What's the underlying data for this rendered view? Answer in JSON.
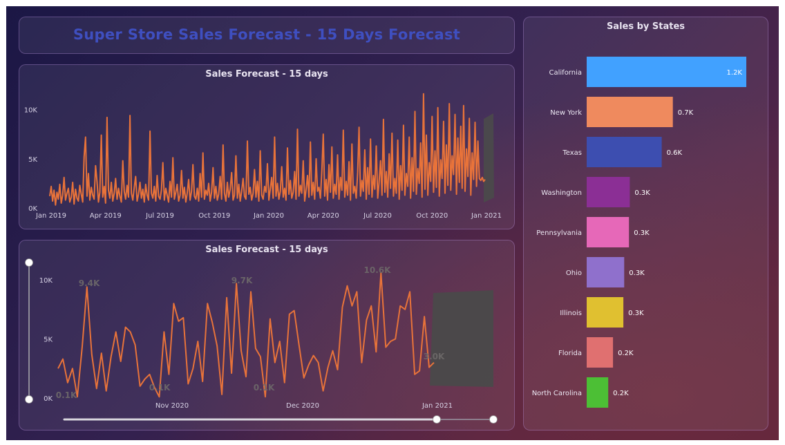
{
  "dashboard": {
    "title": "Super Store Sales Forecast - 15 Days Forecast"
  },
  "colors": {
    "line": "#e8733a",
    "forecast_band": "#4a4a4a",
    "title": "#3f4fc0"
  },
  "chart_data": [
    {
      "type": "line",
      "title": "Sales Forecast - 15 days",
      "x_ticks": [
        "Jan 2019",
        "Apr 2019",
        "Jul 2019",
        "Oct 2019",
        "Jan 2020",
        "Apr 2020",
        "Jul 2020",
        "Oct 2020",
        "Jan 2021"
      ],
      "y_ticks": [
        "0K",
        "5K",
        "10K"
      ],
      "ylim": [
        0,
        12000
      ],
      "x_range": [
        "2019-01-01",
        "2021-01-15"
      ],
      "series": [
        {
          "values": [
            1200,
            2200,
            700,
            1800,
            300,
            1600,
            900,
            2400,
            500,
            1300,
            3100,
            800,
            1500,
            2000,
            600,
            1100,
            2600,
            400,
            1900,
            1000,
            700,
            2300,
            1400,
            600,
            5200,
            7200,
            1200,
            3500,
            800,
            2100,
            1300,
            900,
            4300,
            2700,
            600,
            1600,
            7400,
            1100,
            2200,
            500,
            9200,
            1800,
            1000,
            2600,
            700,
            1500,
            3000,
            900,
            2000,
            1200,
            600,
            4800,
            1700,
            900,
            2300,
            1100,
            9400,
            1500,
            800,
            2100,
            3200,
            700,
            1400,
            2600,
            1000,
            1900,
            600,
            2400,
            1300,
            800,
            7800,
            1500,
            1000,
            2200,
            700,
            3300,
            1200,
            900,
            1800,
            4600,
            800,
            2000,
            1300,
            600,
            2700,
            1100,
            5100,
            900,
            1600,
            2400,
            700,
            1300,
            3800,
            1000,
            2100,
            600,
            1500,
            2900,
            800,
            1700,
            4400,
            1200,
            900,
            2000,
            700,
            3500,
            1100,
            5600,
            900,
            1800,
            1300,
            2500,
            700,
            1600,
            4100,
            1000,
            2200,
            800,
            1400,
            3200,
            900,
            6400,
            1500,
            700,
            2600,
            1100,
            1900,
            3600,
            800,
            1300,
            5300,
            1000,
            2400,
            700,
            1700,
            3000,
            1200,
            900,
            6800,
            1400,
            2100,
            800,
            1500,
            3900,
            1100,
            2700,
            700,
            5800,
            1300,
            900,
            2200,
            1600,
            4500,
            800,
            1900,
            3100,
            1000,
            7200,
            1200,
            2500,
            900,
            1700,
            4200,
            1100,
            2000,
            800,
            6100,
            1400,
            2800,
            1000,
            1600,
            3700,
            900,
            8000,
            1200,
            2300,
            1500,
            4800,
            700,
            1900,
            3300,
            1100,
            6700,
            1300,
            2600,
            900,
            5000,
            1700,
            2100,
            1000,
            3800,
            7500,
            1200,
            2900,
            800,
            4400,
            1600,
            6200,
            1000,
            2400,
            1400,
            5400,
            900,
            3100,
            1800,
            7900,
            1100,
            2700,
            1300,
            4700,
            800,
            6500,
            1500,
            2200,
            1000,
            3600,
            8200,
            1200,
            2800,
            1700,
            5900,
            900,
            4100,
            1400,
            7000,
            1100,
            3300,
            1900,
            6300,
            1000,
            2600,
            4800,
            1300,
            9000,
            1600,
            3700,
            1100,
            5500,
            2000,
            7600,
            1200,
            3000,
            1500,
            6900,
            900,
            4300,
            1800,
            8400,
            1300,
            3500,
            2200,
            7200,
            1000,
            5100,
            1700,
            9800,
            1400,
            4000,
            2500,
            6600,
            1100,
            11600,
            1900,
            7400,
            1300,
            4600,
            2700,
            9300,
            1600,
            5800,
            2100,
            10200,
            1200,
            4900,
            3000,
            8800,
            1500,
            6400,
            2300,
            10600,
            1800,
            5300,
            3400,
            9500,
            1400,
            7100,
            2600,
            8300,
            2000,
            10400,
            1700,
            6000,
            3200,
            9100,
            1300,
            5600,
            2900,
            8700,
            2200,
            6800,
            3000,
            2800,
            3100,
            2700,
            2900
          ]
        }
      ],
      "forecast_band": true
    },
    {
      "type": "line",
      "title": "Sales Forecast - 15 days",
      "x_ticks": [
        "Nov 2020",
        "Dec 2020",
        "Jan 2021"
      ],
      "y_ticks": [
        "0K",
        "5K",
        "10K"
      ],
      "ylim": [
        0,
        11000
      ],
      "x_range": [
        "2020-10-13",
        "2021-01-15"
      ],
      "data_labels": [
        "9.4K",
        "0.1K",
        "9.7K",
        "0.1K",
        "0.1K",
        "10.6K",
        "3.0K"
      ],
      "series": [
        {
          "values": [
            2500,
            3300,
            1300,
            2500,
            100,
            4300,
            9400,
            3700,
            800,
            3800,
            600,
            3500,
            5600,
            3100,
            6000,
            5600,
            4500,
            1000,
            1600,
            2000,
            900,
            100,
            5600,
            2000,
            8000,
            6500,
            6800,
            1200,
            2500,
            4800,
            1400,
            8000,
            6400,
            4400,
            300,
            8500,
            2100,
            9700,
            4000,
            1800,
            9000,
            4200,
            3500,
            100,
            6700,
            3000,
            4800,
            1300,
            7100,
            7400,
            4500,
            1700,
            2800,
            3600,
            3000,
            600,
            2600,
            4000,
            2400,
            7700,
            9500,
            7800,
            9000,
            3000,
            6600,
            7800,
            3900,
            10600,
            4300,
            4800,
            5000,
            7800,
            7500,
            9000,
            2000,
            2300,
            6900,
            2600,
            3000
          ]
        }
      ],
      "forecast_band": true,
      "slider": {
        "vertical_range": [
          0,
          1
        ],
        "horizontal_range": [
          0.86,
          1
        ]
      }
    },
    {
      "type": "bar",
      "orientation": "horizontal",
      "title": "Sales by States",
      "categories": [
        "California",
        "New York",
        "Texas",
        "Washington",
        "Pennsylvania",
        "Ohio",
        "Illinois",
        "Florida",
        "North Carolina"
      ],
      "values": [
        1200,
        700,
        600,
        300,
        300,
        300,
        300,
        200,
        200
      ],
      "labels": [
        "1.2K",
        "0.7K",
        "0.6K",
        "0.3K",
        "0.3K",
        "0.3K",
        "0.3K",
        "0.2K",
        "0.2K"
      ],
      "bar_fill_fractions": [
        1.0,
        0.54,
        0.47,
        0.27,
        0.265,
        0.235,
        0.23,
        0.165,
        0.135
      ],
      "colors": [
        "#41a1ff",
        "#ef8a5e",
        "#3d4eb0",
        "#8b2f95",
        "#e668b8",
        "#8f70cc",
        "#e0c030",
        "#e07070",
        "#4cbf35"
      ]
    }
  ]
}
